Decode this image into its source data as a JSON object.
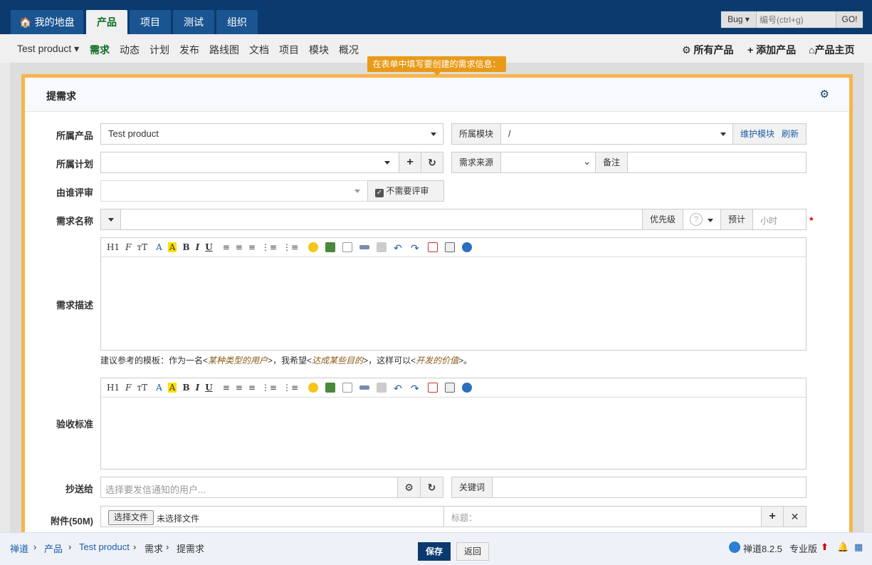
{
  "nav": {
    "tabs": [
      {
        "label": "🏠 我的地盘"
      },
      {
        "label": "产品"
      },
      {
        "label": "项目"
      },
      {
        "label": "测试"
      },
      {
        "label": "组织"
      }
    ]
  },
  "search": {
    "type": "Bug ▾",
    "placeholder": "编号(ctrl+g)",
    "go": "GO!"
  },
  "subnav": {
    "product": "Test product ▾",
    "items": [
      "需求",
      "动态",
      "计划",
      "发布",
      "路线图",
      "文档",
      "项目",
      "模块",
      "概况"
    ],
    "right": [
      "所有产品",
      "添加产品",
      "产品主页"
    ]
  },
  "tip": "在表单中填写要创建的需求信息：",
  "form": {
    "title": "提需求",
    "product_label": "所属产品",
    "product_value": "Test product",
    "module_label": "所属模块",
    "module_value": "/",
    "maintain_module": "维护模块",
    "refresh": "刷新",
    "plan_label": "所属计划",
    "source_label": "需求来源",
    "note_label": "备注",
    "reviewer_label": "由谁评审",
    "no_review": "不需要评审",
    "name_label": "需求名称",
    "priority_label": "优先级",
    "estimate_label": "预计",
    "estimate_placeholder": "小时",
    "required": "*",
    "desc_label": "需求描述",
    "template_hint": {
      "prefix": "建议参考的模板：作为一名<",
      "role": "某种类型的用户",
      "mid1": ">，我希望<",
      "goal": "达成某些目的",
      "mid2": ">，这样可以<",
      "value": "开发的价值",
      "suffix": ">。"
    },
    "verify_label": "验收标准",
    "mailto_label": "抄送给",
    "mailto_placeholder": "选择要发信通知的用户...",
    "keywords_label": "关键词",
    "files_label": "附件(50M)",
    "choose_file": "选择文件",
    "no_file": "未选择文件",
    "file_title": "标题："
  },
  "toolbar": {
    "h": "H1",
    "font": "F",
    "size": "тT",
    "color": "A",
    "bg": "A",
    "bold": "B",
    "italic": "I",
    "underline": "U"
  },
  "footer": {
    "crumbs": [
      "禅道",
      "产品",
      "Test product",
      "需求",
      "提需求"
    ],
    "save": "保存",
    "back": "返回",
    "version": "禅道8.2.5",
    "edition": "专业版"
  }
}
